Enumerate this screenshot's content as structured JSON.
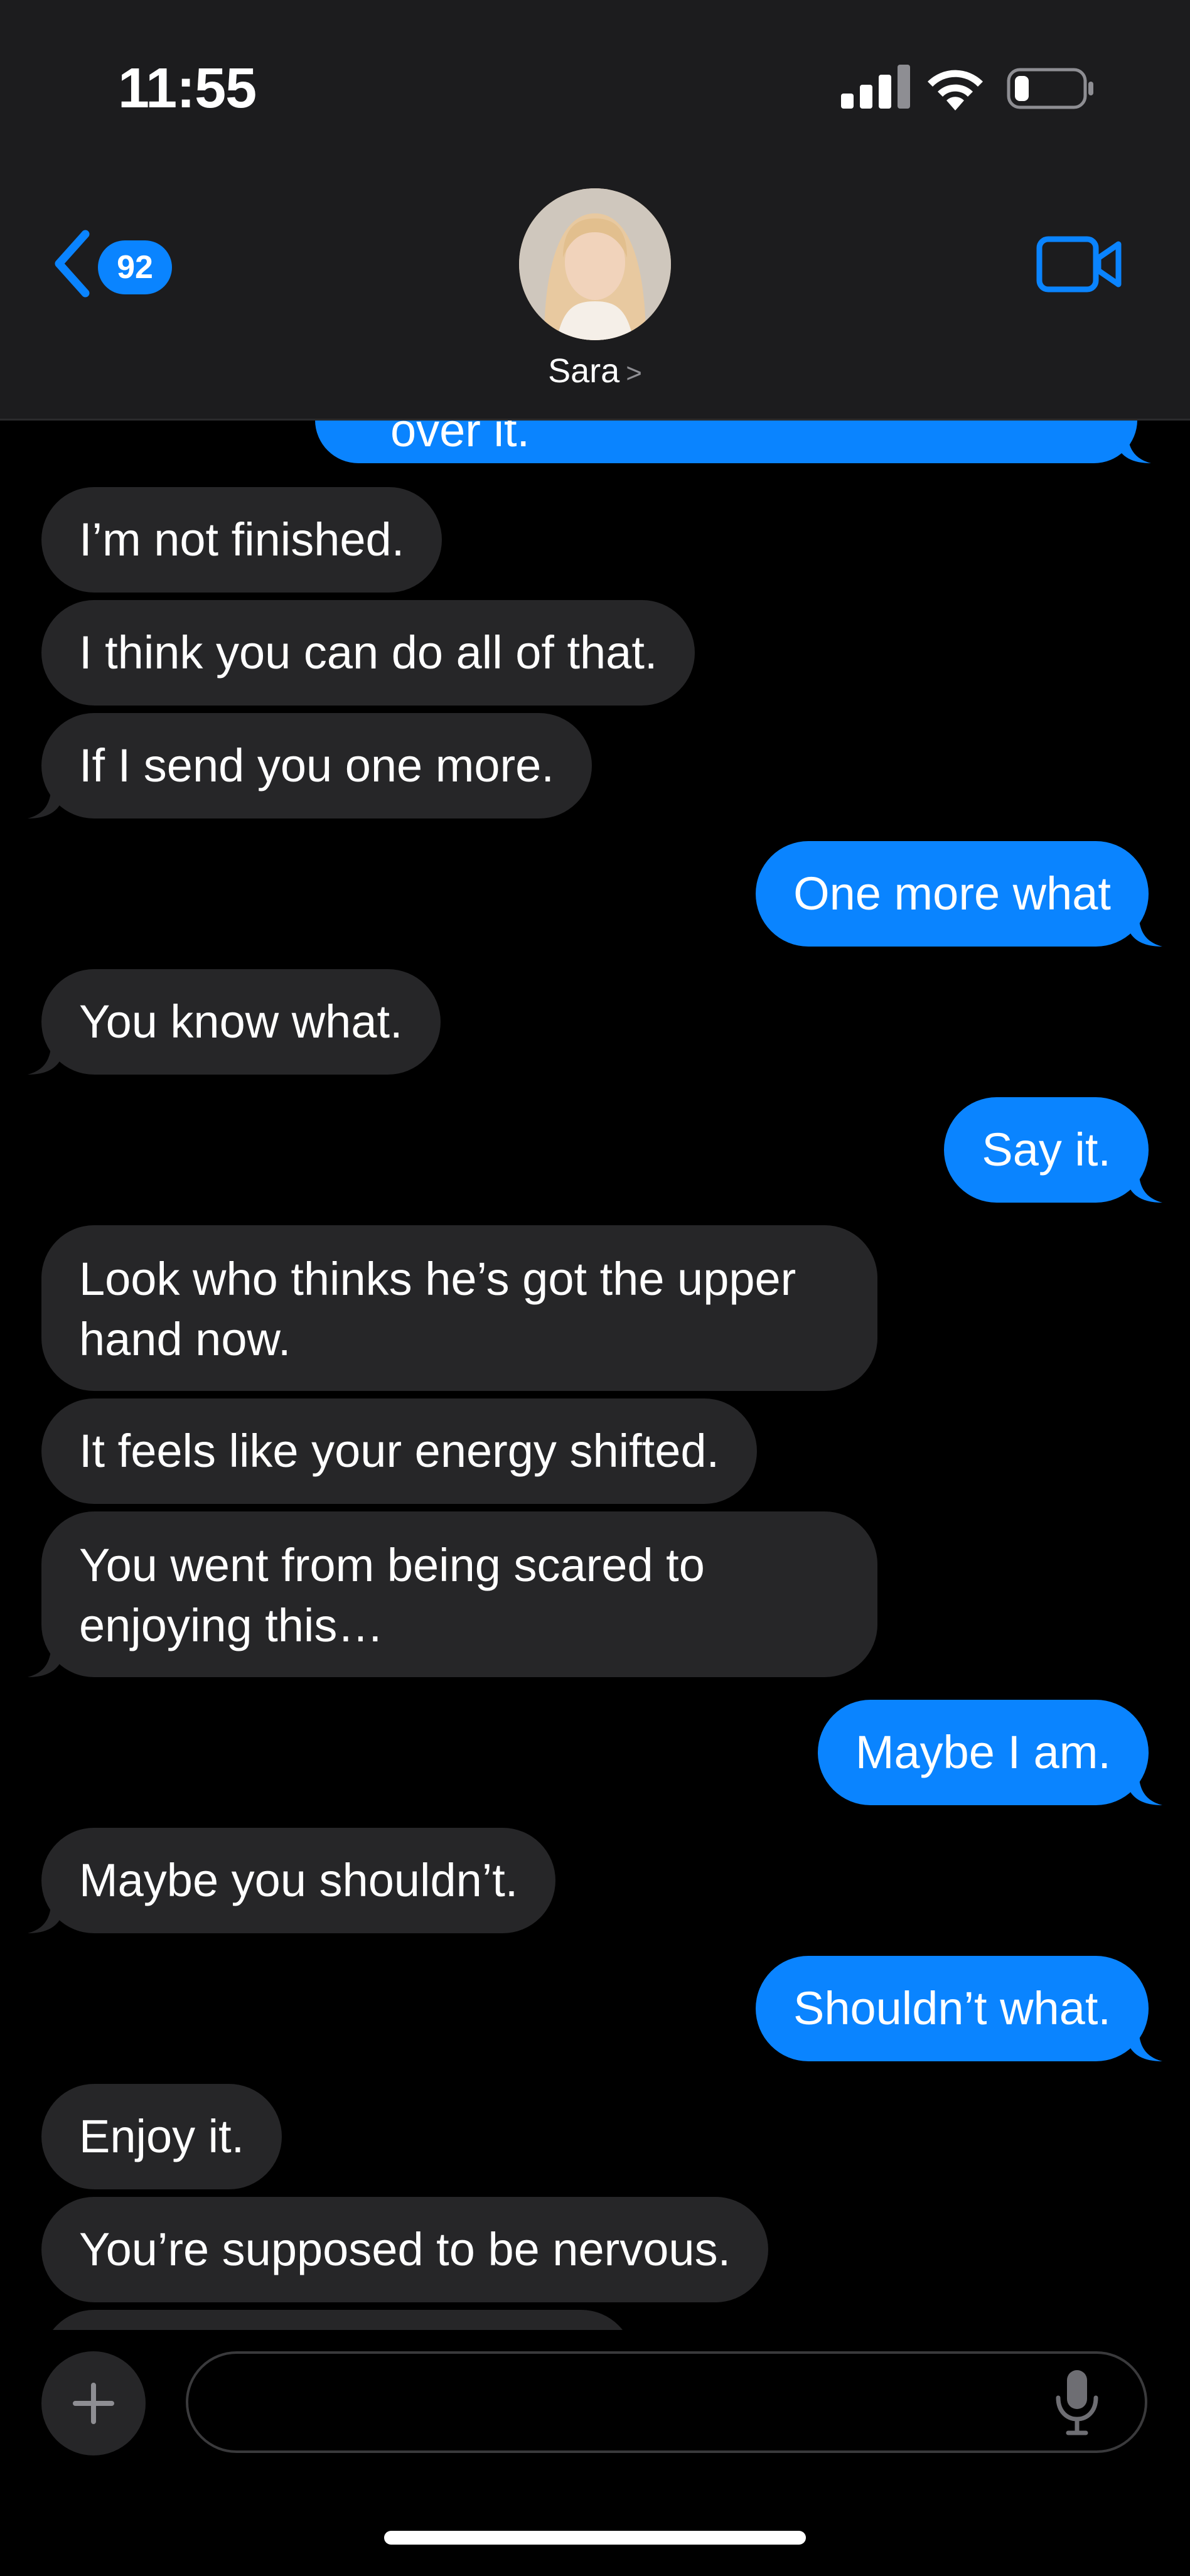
{
  "status_bar": {
    "time": "11:55"
  },
  "header": {
    "back_badge_count": "92",
    "contact_name": "Sara",
    "contact_chevron": ">"
  },
  "messages": [
    {
      "from": "me",
      "text": "over it."
    },
    {
      "from": "them",
      "text": "I’m not finished."
    },
    {
      "from": "them",
      "text": "I think you can do all of that."
    },
    {
      "from": "them",
      "text": "If I send you one more."
    },
    {
      "from": "me",
      "text": "One more what"
    },
    {
      "from": "them",
      "text": "You know what."
    },
    {
      "from": "me",
      "text": "Say it."
    },
    {
      "from": "them",
      "text": "Look who thinks he’s got the upper hand now."
    },
    {
      "from": "them",
      "text": "It feels like your energy shifted."
    },
    {
      "from": "them",
      "text": "You went from being scared to enjoying this…"
    },
    {
      "from": "me",
      "text": "Maybe I am."
    },
    {
      "from": "them",
      "text": "Maybe you shouldn’t."
    },
    {
      "from": "me",
      "text": "Shouldn’t what."
    },
    {
      "from": "them",
      "text": "Enjoy it."
    },
    {
      "from": "them",
      "text": "You’re supposed to be nervous."
    }
  ],
  "composer": {
    "value": "",
    "placeholder": ""
  },
  "colors": {
    "accent": "#0a84ff",
    "incoming_bubble": "#262628",
    "header_bg": "#1c1c1e"
  },
  "icons": {
    "back": "chevron-left-icon",
    "video": "video-camera-icon",
    "plus": "plus-icon",
    "mic": "microphone-icon",
    "signal": "cellular-signal-icon",
    "wifi": "wifi-icon",
    "battery": "battery-icon"
  }
}
